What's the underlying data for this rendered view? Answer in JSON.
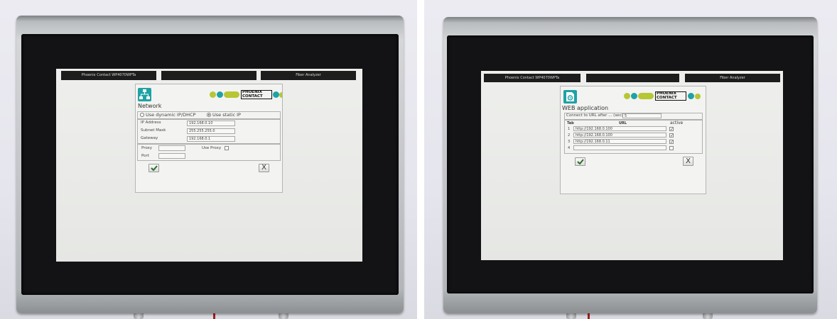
{
  "colors": {
    "accent_teal": "#1ea2a6",
    "brand_green": "#b7c634",
    "tab_background": "#1d1d1d",
    "ok_green": "#2b6e2b"
  },
  "left_panel": {
    "tabs": {
      "tab1": "Phoenix Contact WP4070WPTa",
      "tab3": "Fiber Analyzer"
    },
    "brand": {
      "line1": "PHOENIX",
      "line2": "CONTACT"
    },
    "dialog": {
      "icon": "network-icon",
      "title": "Network",
      "dhcp_label": "Use dynamic IP/DHCP",
      "static_label": "Use static IP",
      "use_dhcp": false,
      "use_static": true,
      "fields": [
        {
          "label": "IP Address",
          "value": "192.168.0.10"
        },
        {
          "label": "Subnet Mask",
          "value": "255.255.255.0"
        },
        {
          "label": "Gateway",
          "value": "192.168.0.1"
        }
      ],
      "proxy_label": "Proxy",
      "use_proxy_label": "Use Proxy",
      "use_proxy": false,
      "port_label": "Port",
      "ok_icon": "checkmark-icon",
      "cancel_label": "X"
    }
  },
  "right_panel": {
    "tabs": {
      "tab1": "Phoenix Contact WP4070WPTa",
      "tab3": "Fiber Analyzer"
    },
    "brand": {
      "line1": "PHOENIX",
      "line2": "CONTACT"
    },
    "dialog": {
      "icon": "web-document-icon",
      "title": "WEB application",
      "connect_label": "Connect to URL after ... (sec)",
      "connect_value": "5",
      "columns": {
        "tab": "Tab",
        "url": "URL",
        "active": "active"
      },
      "rows": [
        {
          "tab": "1",
          "url": "http://192.168.0.100",
          "active": true
        },
        {
          "tab": "2",
          "url": "http://192.168.0.100",
          "active": true
        },
        {
          "tab": "3",
          "url": "http://192.168.0.11",
          "active": true
        },
        {
          "tab": "4",
          "active": false
        }
      ],
      "ok_icon": "checkmark-icon",
      "cancel_label": "X"
    }
  }
}
